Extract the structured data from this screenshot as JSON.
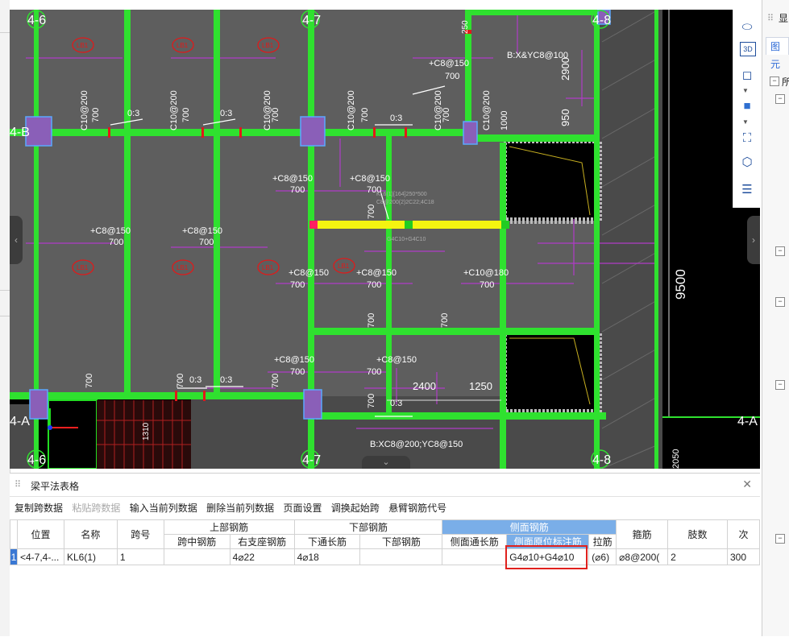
{
  "canvas": {
    "axis_labels": {
      "a_4_6_top": "4-6",
      "a_4_7_top": "4-7",
      "a_4_8_top": "4-8",
      "a_4_6_bot": "4-6",
      "a_4_7_bot": "4-7",
      "a_4_8_bot": "4-8",
      "a_4_b": "4-B",
      "a_4_a_left": "4-A",
      "a_4_a_right": "4-A"
    },
    "dims": {
      "d9500": "9500",
      "d2900": "2900",
      "d950": "950",
      "d2400": "2400",
      "d1250": "1250",
      "d2050": "2050",
      "d1310": "1310"
    },
    "slab_tag": "LB1",
    "rebar_c8_150": "+C8@150",
    "rebar_c10_180": "+C10@180",
    "rebar_c10_200": "C10@200",
    "val_700": "700",
    "ratio_03": "0:3",
    "bx_top": "B:X&YC8@100",
    "bx_bot": "B:XC8@200;YC8@150",
    "beam_note_1": "KL6(1)[164]250*500",
    "beam_note_2": "C8@200(2)2C22;4C18",
    "beam_note_3": "G4C10+G4C10",
    "dim_1000": "1000",
    "dim_250": "250"
  },
  "view_toolbar": {
    "icons": [
      "ellipse-icon",
      "3d-icon",
      "cube-outline-icon",
      "cube-filled-icon",
      "fit-view-icon",
      "rotate-view-icon",
      "layer-list-icon"
    ],
    "label_3d": "3D"
  },
  "right_panel": {
    "tab_label": "图元",
    "title_char": "显",
    "tree_char": "所"
  },
  "bottom_panel": {
    "title": "梁平法表格",
    "actions": [
      "复制跨数据",
      "粘贴跨数据",
      "输入当前列数据",
      "删除当前列数据",
      "页面设置",
      "调换起始跨",
      "悬臂钢筋代号"
    ],
    "disabled_action_index": 1,
    "headers": {
      "position": "位置",
      "name": "名称",
      "span_no": "跨号",
      "top_rebar": "上部钢筋",
      "bottom_rebar": "下部钢筋",
      "side_rebar": "侧面钢筋",
      "mid_span": "跨中钢筋",
      "right_support": "右支座钢筋",
      "bottom_through": "下通长筋",
      "bottom_rebar_col": "下部钢筋",
      "side_through": "侧面通长筋",
      "side_origin": "侧面原位标注筋",
      "tie_bar": "拉筋",
      "stirrup": "箍筋",
      "legs": "肢数",
      "next": "次"
    },
    "row": {
      "no": "1",
      "position": "<4-7,4-...",
      "name": "KL6(1)",
      "span_no": "1",
      "mid_span": "",
      "right_support": "4⌀22",
      "bottom_through": "4⌀18",
      "bottom_rebar": "",
      "side_through": "",
      "side_origin": "G4⌀10+G4⌀10",
      "tie_bar": "(⌀6)",
      "stirrup": "⌀8@200(",
      "legs": "2",
      "next": "300"
    }
  }
}
